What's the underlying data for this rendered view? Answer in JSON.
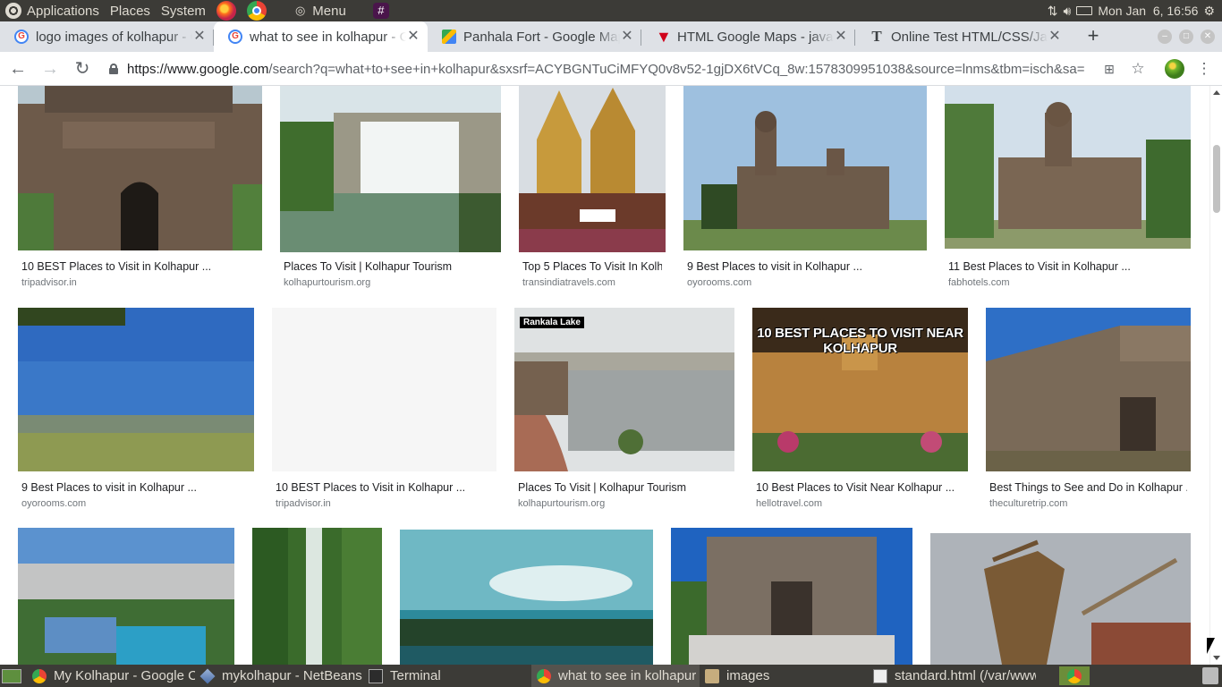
{
  "top_panel": {
    "menus": [
      "Applications",
      "Places",
      "System"
    ],
    "menu_label": "Menu",
    "clock": "Mon Jan  6, 16:56"
  },
  "tabs": [
    {
      "title": "logo images of kolhapur - Google Search",
      "favicon": "google-icon"
    },
    {
      "title": "what to see in kolhapur - Google Search",
      "favicon": "google-icon",
      "active": true
    },
    {
      "title": "Panhala Fort - Google Maps",
      "favicon": "maps-icon"
    },
    {
      "title": "HTML Google Maps - javatpoint",
      "favicon": "w3-icon"
    },
    {
      "title": "Online Test HTML/CSS/JavaScript",
      "favicon": "t-icon"
    }
  ],
  "toolbar": {
    "url_domain": "https://www.google.com",
    "url_path": "/search?q=what+to+see+in+kolhapur&sxsrf=ACYBGNTuCiMFYQ0v8v52-1gjDX6tVCq_8w:1578309951038&source=lnms&tbm=isch&sa=X&ved=..."
  },
  "results": [
    {
      "caption": "10 BEST Places to Visit in Kolhapur ...",
      "domain": "tripadvisor.in"
    },
    {
      "caption": "Places To Visit | Kolhapur Tourism",
      "domain": "kolhapurtourism.org"
    },
    {
      "caption": "Top 5 Places To Visit In Kolhapur ...",
      "domain": "transindiatravels.com"
    },
    {
      "caption": "9 Best Places to visit in Kolhapur ...",
      "domain": "oyorooms.com"
    },
    {
      "caption": "11 Best Places to Visit in Kolhapur ...",
      "domain": "fabhotels.com"
    },
    {
      "caption": "9 Best Places to visit in Kolhapur ...",
      "domain": "oyorooms.com"
    },
    {
      "caption": "10 BEST Places to Visit in Kolhapur ...",
      "domain": "tripadvisor.in"
    },
    {
      "caption": "Places To Visit | Kolhapur Tourism",
      "domain": "kolhapurtourism.org",
      "overlay": "Rankala Lake"
    },
    {
      "caption": "10 Best Places to Visit Near Kolhapur ...",
      "domain": "hellotravel.com",
      "overlay": "10 BEST PLACES TO VISIT NEAR KOLHAPUR"
    },
    {
      "caption": "Best Things to See and Do in Kolhapur ...",
      "domain": "theculturetrip.com"
    }
  ],
  "taskbar": [
    {
      "label": "My Kolhapur - Google Chrome",
      "icon": "chrome-icon"
    },
    {
      "label": "mykolhapur - NetBeans IDE",
      "icon": "netbeans-icon"
    },
    {
      "label": "Terminal",
      "icon": "terminal-icon"
    },
    {
      "label": "what to see in kolhapur - Google Chrome",
      "icon": "chrome-icon",
      "active": true
    },
    {
      "label": "images",
      "icon": "folder-icon"
    },
    {
      "label": "standard.html (/var/www/html)",
      "icon": "text-editor-icon"
    }
  ]
}
